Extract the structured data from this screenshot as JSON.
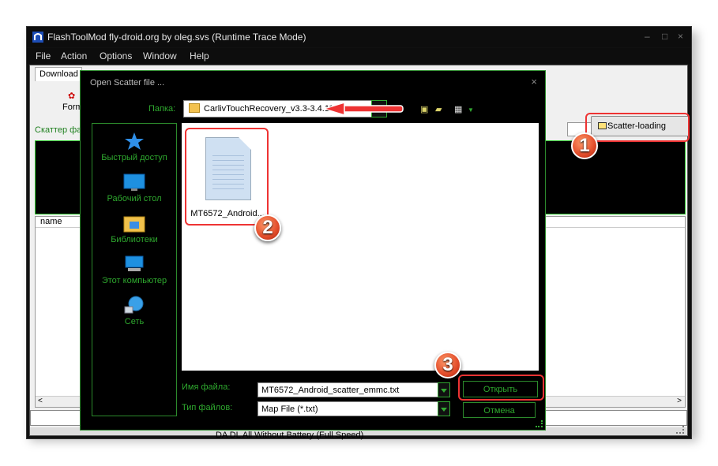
{
  "window": {
    "title": "FlashToolMod fly-droid.org by oleg.svs (Runtime Trace Mode)",
    "controls": {
      "minimize": "–",
      "maximize": "□",
      "close": "×"
    }
  },
  "menu": {
    "items": [
      "File",
      "Action",
      "Options",
      "Window",
      "Help"
    ]
  },
  "main": {
    "tab_download": "Download",
    "format_label": "Form",
    "scatter_label": "Скаттер фа",
    "scatter_button": "Scatter-loading",
    "table_header_name": "name",
    "status_text": "DA DL All Without Battery (Full Speed)"
  },
  "dialog": {
    "title": "Open Scatter file ...",
    "close": "×",
    "folder_label": "Папка:",
    "folder_value": "CarlivTouchRecovery_v3.3-3.4.113",
    "places": [
      {
        "label": "Быстрый доступ",
        "icon": "star-icon"
      },
      {
        "label": "Рабочий стол",
        "icon": "desktop-icon"
      },
      {
        "label": "Библиотеки",
        "icon": "libraries-icon"
      },
      {
        "label": "Этот компьютер",
        "icon": "computer-icon"
      },
      {
        "label": "Сеть",
        "icon": "network-icon"
      }
    ],
    "file_item": "MT6572_Android...",
    "filename_label": "Имя файла:",
    "filename_value": "MT6572_Android_scatter_emmc.txt",
    "filetype_label": "Тип файлов:",
    "filetype_value": "Map File (*.txt)",
    "open_button": "Открыть",
    "cancel_button": "Отмена"
  },
  "annotations": {
    "step1": "1",
    "step2": "2",
    "step3": "3"
  },
  "colors": {
    "accent_green": "#2ea82e",
    "highlight_red": "#e33333"
  }
}
